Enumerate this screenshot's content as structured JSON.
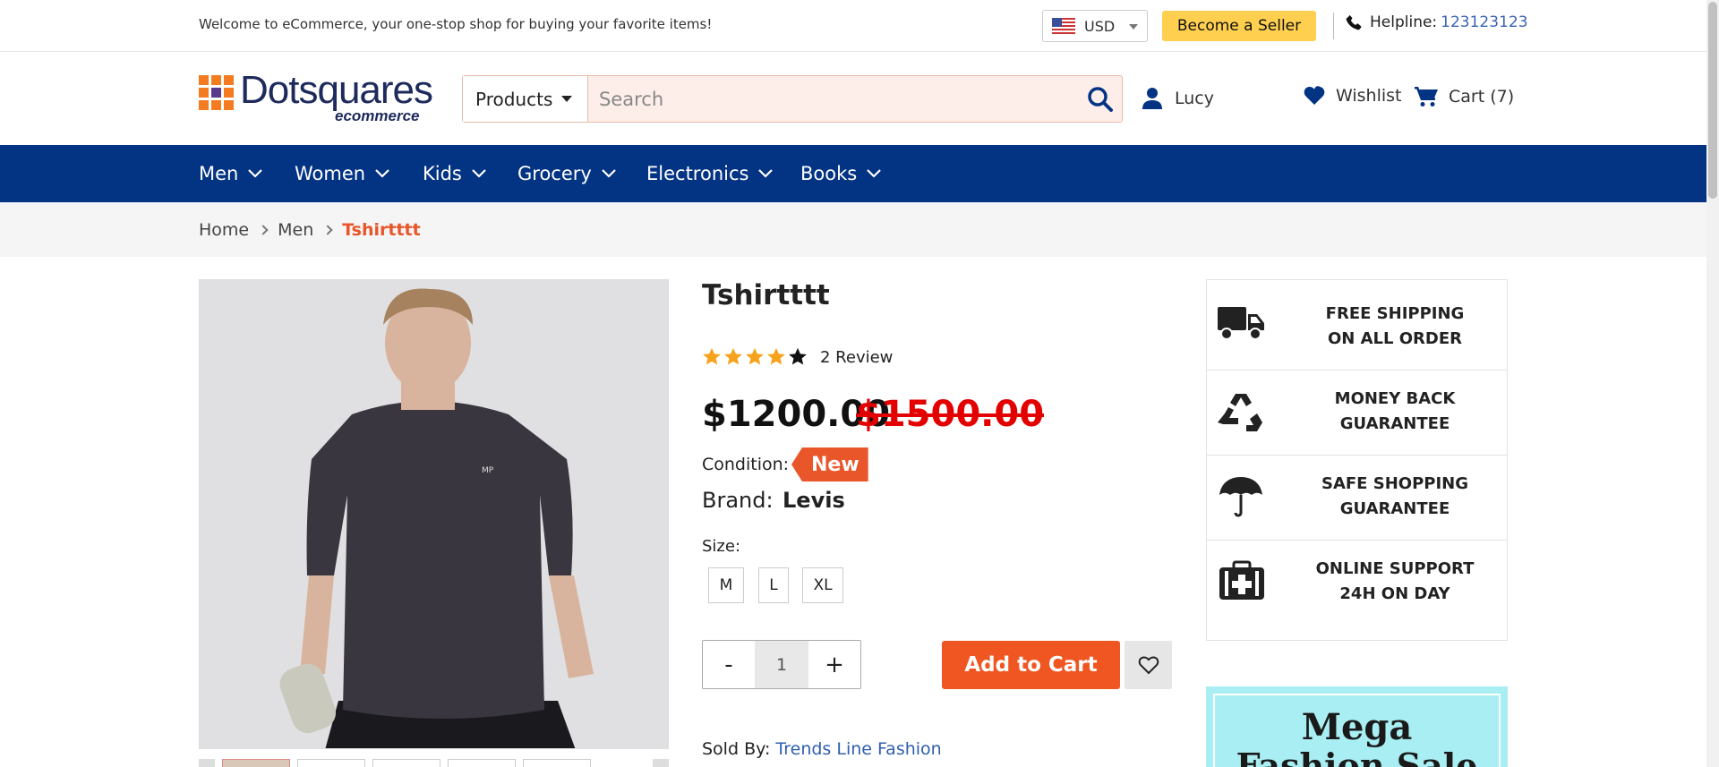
{
  "topbar": {
    "welcome": "Welcome to eCommerce, your one-stop shop for buying your favorite items!",
    "currency": "USD",
    "seller_button": "Become a Seller",
    "helpline_label": "Helpline:",
    "helpline_number": "123123123"
  },
  "header": {
    "logo_text": "Dotsquares",
    "logo_sub": "ecommerce",
    "search_category": "Products",
    "search_placeholder": "Search",
    "user_name": "Lucy",
    "wishlist_label": "Wishlist",
    "cart_label": "Cart (7)"
  },
  "nav": {
    "items": [
      {
        "label": "Men"
      },
      {
        "label": "Women"
      },
      {
        "label": "Kids"
      },
      {
        "label": "Grocery"
      },
      {
        "label": "Electronics"
      },
      {
        "label": "Books"
      }
    ]
  },
  "breadcrumb": {
    "items": [
      "Home",
      "Men"
    ],
    "current": "Tshirtttt"
  },
  "product": {
    "title": "Tshirtttt",
    "rating": 4,
    "rating_max": 5,
    "reviews": "2 Review",
    "price": "$1200.00",
    "old_price": "$1500.00",
    "condition_label": "Condition:",
    "condition_value": "New",
    "brand_label": "Brand:",
    "brand_value": "Levis",
    "size_label": "Size:",
    "sizes": [
      "M",
      "L",
      "XL"
    ],
    "qty_minus": "-",
    "qty_value": "1",
    "qty_plus": "+",
    "add_to_cart": "Add to Cart",
    "sold_by_label": "Sold By:",
    "sold_by_value": "Trends Line Fashion",
    "shirt_logo": "MP"
  },
  "services": [
    {
      "text": "FREE SHIPPING\nON ALL ORDER",
      "icon": "truck-icon"
    },
    {
      "text": "MONEY BACK\nGUARANTEE",
      "icon": "recycle-icon"
    },
    {
      "text": "SAFE SHOPPING\nGUARANTEE",
      "icon": "umbrella-icon"
    },
    {
      "text": "ONLINE SUPPORT\n24H ON DAY",
      "icon": "first-aid-icon"
    }
  ],
  "banner": {
    "line1": "Mega",
    "line2": "Fashion Sale"
  },
  "colors": {
    "nav_bg": "#033383",
    "accent": "#ef5622",
    "seller_button": "#ffcf4f",
    "old_price": "#e30000",
    "star": "#f7a21b"
  }
}
